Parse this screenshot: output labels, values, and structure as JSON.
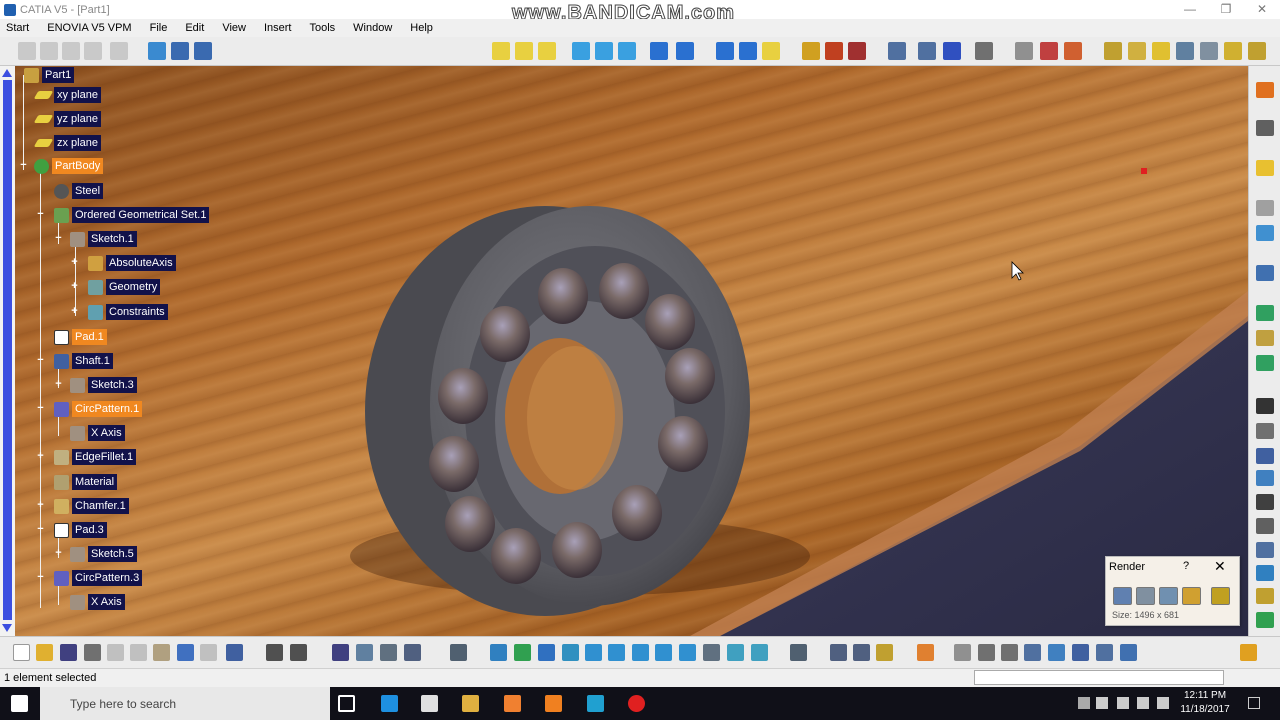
{
  "window": {
    "title": "CATIA V5 - [Part1]",
    "watermark": "www.BANDICAM.com",
    "controls": [
      "—",
      "❐",
      "✕"
    ]
  },
  "menu": [
    "Start",
    "ENOVIA V5 VPM",
    "File",
    "Edit",
    "View",
    "Insert",
    "Tools",
    "Window",
    "Help"
  ],
  "tree": {
    "root": "Part1",
    "nodes": [
      {
        "label": "xy plane",
        "icon": "plane-icon"
      },
      {
        "label": "yz plane",
        "icon": "plane-icon"
      },
      {
        "label": "zx plane",
        "icon": "plane-icon"
      },
      {
        "label": "PartBody",
        "icon": "body-icon",
        "selected": true
      },
      {
        "label": "Steel",
        "icon": "material-sphere-icon"
      },
      {
        "label": "Ordered Geometrical Set.1",
        "icon": "geoset-icon"
      },
      {
        "label": "Sketch.1",
        "icon": "sketch-icon"
      },
      {
        "label": "AbsoluteAxis",
        "icon": "axis-icon"
      },
      {
        "label": "Geometry",
        "icon": "geometry-icon"
      },
      {
        "label": "Constraints",
        "icon": "constraints-icon"
      },
      {
        "label": "Pad.1",
        "icon": "pad-icon",
        "selected": true
      },
      {
        "label": "Shaft.1",
        "icon": "shaft-icon"
      },
      {
        "label": "Sketch.3",
        "icon": "sketch-icon"
      },
      {
        "label": "CircPattern.1",
        "icon": "circpattern-icon",
        "selected": true
      },
      {
        "label": "X Axis",
        "icon": "axis-line-icon"
      },
      {
        "label": "EdgeFillet.1",
        "icon": "fillet-icon"
      },
      {
        "label": "Material",
        "icon": "material-icon"
      },
      {
        "label": "Chamfer.1",
        "icon": "chamfer-icon"
      },
      {
        "label": "Pad.3",
        "icon": "pad-icon"
      },
      {
        "label": "Sketch.5",
        "icon": "sketch-icon"
      },
      {
        "label": "CircPattern.3",
        "icon": "circpattern-icon"
      },
      {
        "label": "X Axis",
        "icon": "axis-line-icon"
      }
    ]
  },
  "render_dialog": {
    "title": "Render",
    "help": "?",
    "close": "✕",
    "size_text": "Size: 1496 x 681"
  },
  "status": {
    "text": "1 element selected"
  },
  "taskbar": {
    "search_placeholder": "Type here to search",
    "time": "12:11 PM",
    "date": "11/18/2017"
  },
  "colors": {
    "tree_label_bg": "#12124a",
    "tree_selected_bg": "#f08820",
    "scrollbar_thumb": "#3c4fe0",
    "bearing": "#6a6a70",
    "wood": "#b06a2d"
  }
}
